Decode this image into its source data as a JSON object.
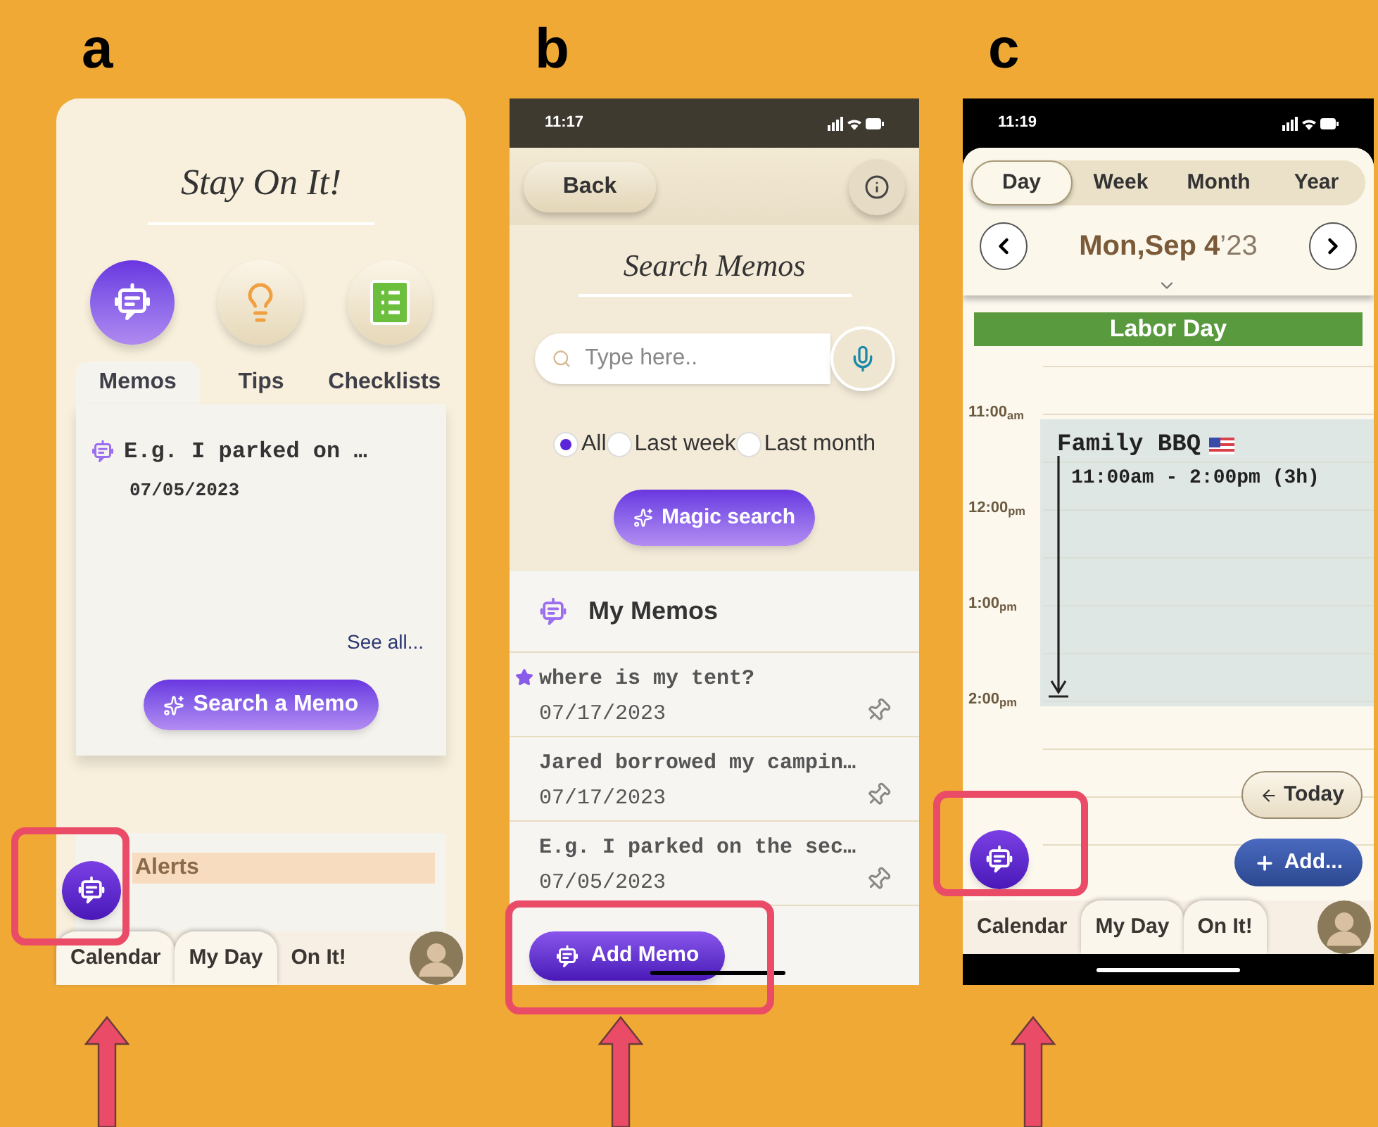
{
  "panels": [
    {
      "kind": "home",
      "label": "a",
      "highlighted": true,
      "title": "Stay On It!",
      "feature_buttons": [
        {
          "kind": "memo",
          "selected": true
        },
        {
          "kind": "tips",
          "selected": false
        },
        {
          "kind": "checklist",
          "selected": false
        }
      ],
      "tabs": [
        {
          "label": "Memos",
          "selected": true
        },
        {
          "label": "Tips",
          "selected": false
        },
        {
          "label": "Checklists",
          "selected": false
        }
      ],
      "memo": {
        "text": "E.g. I parked on …",
        "date": "07/05/2023"
      },
      "see_all": "See all...",
      "search_button": "Search a Memo",
      "alerts_title": "Alerts",
      "bottom_tabs": [
        {
          "label": "Calendar",
          "selected": false
        },
        {
          "label": "My Day",
          "selected": false
        },
        {
          "label": "On It!",
          "selected": true
        }
      ]
    },
    {
      "kind": "search",
      "label": "b",
      "highlighted": true,
      "time": "11:17",
      "back": "Back",
      "title": "Search Memos",
      "placeholder": "Type here..",
      "filters": [
        {
          "label": "All",
          "selected": true
        },
        {
          "label": "Last week",
          "selected": false
        },
        {
          "label": "Last month",
          "selected": false
        }
      ],
      "magic_button": "Magic search",
      "list_title": "My Memos",
      "memos": [
        {
          "text": "where is my tent?",
          "date": "07/17/2023",
          "flagged": true
        },
        {
          "text": "Jared borrowed my campin…",
          "date": "07/17/2023",
          "flagged": false
        },
        {
          "text": "E.g. I parked on the sec…",
          "date": "07/05/2023",
          "flagged": false
        }
      ],
      "add_button": "Add Memo"
    },
    {
      "kind": "calendar",
      "label": "c",
      "highlighted": true,
      "time": "11:19",
      "views": [
        {
          "label": "Day",
          "selected": true
        },
        {
          "label": "Week",
          "selected": false
        },
        {
          "label": "Month",
          "selected": false
        },
        {
          "label": "Year",
          "selected": false
        }
      ],
      "date": "Mon,Sep 4",
      "year": "’23",
      "holiday": "Labor Day",
      "hours": [
        {
          "time": "11:00",
          "period": "am"
        },
        {
          "time": "12:00",
          "period": "pm"
        },
        {
          "time": "1:00",
          "period": "pm"
        },
        {
          "time": "2:00",
          "period": "pm"
        }
      ],
      "event": {
        "title": "Family BBQ",
        "time": "11:00am - 2:00pm (3h)"
      },
      "today_button": "Today",
      "add_button": "Add...",
      "bottom_tabs": [
        {
          "label": "Calendar",
          "selected": true
        },
        {
          "label": "My Day",
          "selected": false
        },
        {
          "label": "On It!",
          "selected": false
        }
      ]
    }
  ]
}
